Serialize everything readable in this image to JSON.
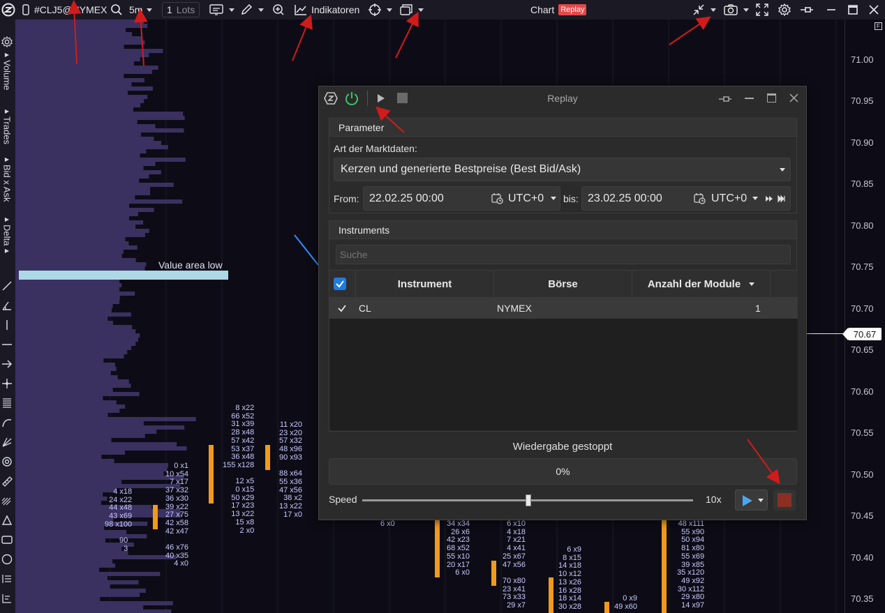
{
  "toolbar": {
    "symbol": "#CLJ5@NYMEX",
    "timeframe": "5m",
    "lots_value": "1",
    "lots_unit": "Lots",
    "indicators_label": "Indikatoren",
    "chart_title": "Chart",
    "replay_badge": "Replay"
  },
  "left_panel": {
    "labels": [
      "Volume",
      "Trades",
      "Bid x Ask",
      "Delta"
    ]
  },
  "chart": {
    "value_area_label": "Value area low",
    "price_ticks": [
      "71.00",
      "70.95",
      "70.90",
      "70.85",
      "70.80",
      "70.75",
      "70.70",
      "70.65",
      "70.60",
      "70.55",
      "70.50",
      "70.45",
      "70.40",
      "70.35"
    ],
    "current_price": "70.67",
    "footprint_columns": [
      {
        "text": "4 x18\n24 x22\n44 x48\n43 x69\n98 x100"
      },
      {
        "text": "0 x1\n10 x54\n7 x17\n37 x32\n36 x30\n39 x22\n27 x75\n42 x58\n42 x47\n\n46 x76\n40 x35\n4 x0"
      },
      {
        "text": "90\n3"
      },
      {
        "text": "8 x22\n66 x52\n31 x39\n28 x48\n57 x42\n53 x37\n36 x48\n155 x128\n\n12 x5\n0 x15\n50 x29\n17 x23\n13 x22\n15 x8\n2 x0"
      },
      {
        "text": "11 x20\n23 x20\n57 x32\n48 x96\n90 x93\n\n88 x64\n55 x36\n47 x56\n38 x2\n13 x22\n17 x0"
      },
      {
        "text": "6 x0"
      },
      {
        "text": "34 x34\n26 x6\n42 x23\n68 x52\n55 x10\n20 x17\n6 x0"
      },
      {
        "text": "6 x10\n4 x18\n7 x21\n4 x41\n25 x67\n47 x56\n\n70 x80\n23 x41\n73 x33\n29 x7"
      },
      {
        "text": "6 x9\n8 x15\n14 x18\n10 x12\n13 x26\n16 x28\n18 x14\n30 x28"
      },
      {
        "text": "0 x9\n49 x60"
      },
      {
        "text": "48 x111\n55 x90\n50 x94\n81 x80\n55 x69\n39 x85\n35 x120\n49 x92\n30 x112\n29 x80\n14 x97"
      }
    ]
  },
  "replay_dialog": {
    "title": "Replay",
    "parameter_header": "Parameter",
    "market_data_label": "Art der Marktdaten:",
    "market_data_value": "Kerzen und generierte Bestpreise (Best Bid/Ask)",
    "from_label": "From:",
    "from_value": "22.02.25 00:00",
    "from_tz": "UTC+0",
    "to_label": "bis:",
    "to_value": "23.02.25 00:00",
    "to_tz": "UTC+0",
    "instruments_header": "Instruments",
    "search_placeholder": "Suche",
    "columns": [
      "Instrument",
      "Börse",
      "Anzahl der Module"
    ],
    "rows": [
      {
        "instrument": "CL",
        "exchange": "NYMEX",
        "modules": "1"
      }
    ],
    "status": "Wiedergabe gestoppt",
    "progress_text": "0%",
    "progress": 0,
    "speed_label": "Speed",
    "speed_value": "10x"
  },
  "colors": {
    "volume_profile": "#3a3160",
    "value_area": "#add8e6",
    "candle": "#f29a1c",
    "accent_blue": "#1e7ce0",
    "power_green": "#3cc36a",
    "stop_red": "#8b2f23",
    "annotation_arrow": "#d11b1b"
  }
}
